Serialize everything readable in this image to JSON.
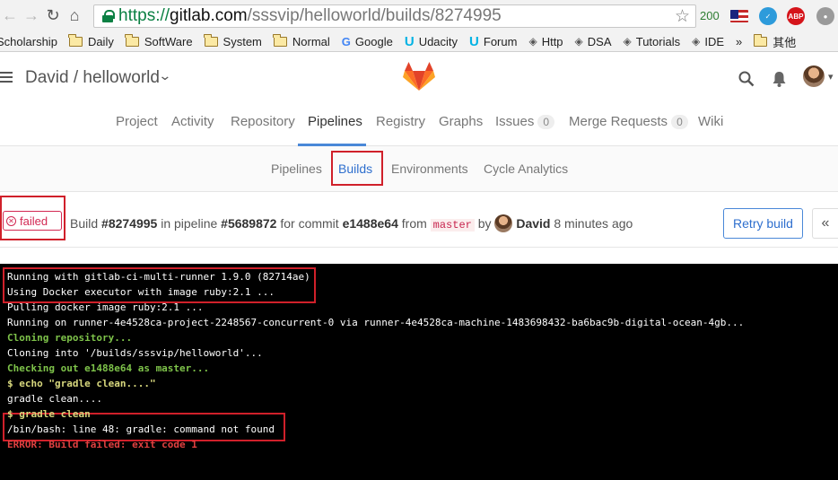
{
  "browser": {
    "url_scheme": "https://",
    "url_host": "gitlab.com",
    "url_path": "/sssvip/helloworld/builds/8274995",
    "extension_count": "200",
    "abp_label": "ABP"
  },
  "bookmarks": [
    {
      "label": "Scholarship",
      "kind": "folder"
    },
    {
      "label": "Daily",
      "kind": "folder"
    },
    {
      "label": "SoftWare",
      "kind": "folder"
    },
    {
      "label": "System",
      "kind": "folder"
    },
    {
      "label": "Normal",
      "kind": "folder"
    },
    {
      "label": "Google",
      "kind": "google"
    },
    {
      "label": "Udacity",
      "kind": "udacity"
    },
    {
      "label": "Forum",
      "kind": "udacity"
    },
    {
      "label": "Http",
      "kind": "diamond"
    },
    {
      "label": "DSA",
      "kind": "diamond"
    },
    {
      "label": "Tutorials",
      "kind": "diamond"
    },
    {
      "label": "IDE",
      "kind": "diamond"
    }
  ],
  "bookmarks_more": "»",
  "bookmarks_other": "其他",
  "header": {
    "project_title": "David / helloworld"
  },
  "main_tabs": [
    {
      "label": "Project"
    },
    {
      "label": "Activity"
    },
    {
      "label": "Repository"
    },
    {
      "label": "Pipelines"
    },
    {
      "label": "Registry"
    },
    {
      "label": "Graphs"
    },
    {
      "label": "Issues",
      "count": "0"
    },
    {
      "label": "Merge Requests",
      "count": "0"
    },
    {
      "label": "Wiki"
    }
  ],
  "sub_tabs": [
    {
      "label": "Pipelines"
    },
    {
      "label": "Builds"
    },
    {
      "label": "Environments"
    },
    {
      "label": "Cycle Analytics"
    }
  ],
  "build": {
    "status": "failed",
    "prefix": "Build ",
    "build_id": "#8274995",
    "in_pipeline": " in pipeline ",
    "pipeline_id": "#5689872",
    "for_commit": " for commit ",
    "commit": "e1488e64",
    "from": " from ",
    "branch": "master",
    "by": " by ",
    "author": "David",
    "time": " 8 minutes ago",
    "retry_label": "Retry build",
    "collapse_label": "«"
  },
  "log": [
    {
      "text": "Running with gitlab-ci-multi-runner 1.9.0 (82714ae)",
      "style": "normal"
    },
    {
      "text": "Using Docker executor with image ruby:2.1 ...",
      "style": "normal"
    },
    {
      "text": "Pulling docker image ruby:2.1 ...",
      "style": "normal"
    },
    {
      "text": "Running on runner-4e4528ca-project-2248567-concurrent-0 via runner-4e4528ca-machine-1483698432-ba6bac9b-digital-ocean-4gb...",
      "style": "normal"
    },
    {
      "text": "Cloning repository...",
      "style": "green"
    },
    {
      "text": "Cloning into '/builds/sssvip/helloworld'...",
      "style": "normal"
    },
    {
      "text": "Checking out e1488e64 as master...",
      "style": "green"
    },
    {
      "text": "$ echo \"gradle clean....\"",
      "style": "yellow"
    },
    {
      "text": "gradle clean....",
      "style": "normal"
    },
    {
      "text": "$ gradle clean",
      "style": "yellow"
    },
    {
      "text": "/bin/bash: line 48: gradle: command not found",
      "style": "normal"
    },
    {
      "text": "ERROR: Build failed: exit code 1",
      "style": "red"
    }
  ],
  "colors": {
    "accent": "#4a88d8",
    "failed": "#d22852",
    "highlight_box": "#d0202a",
    "terminal_bg": "#000000"
  }
}
